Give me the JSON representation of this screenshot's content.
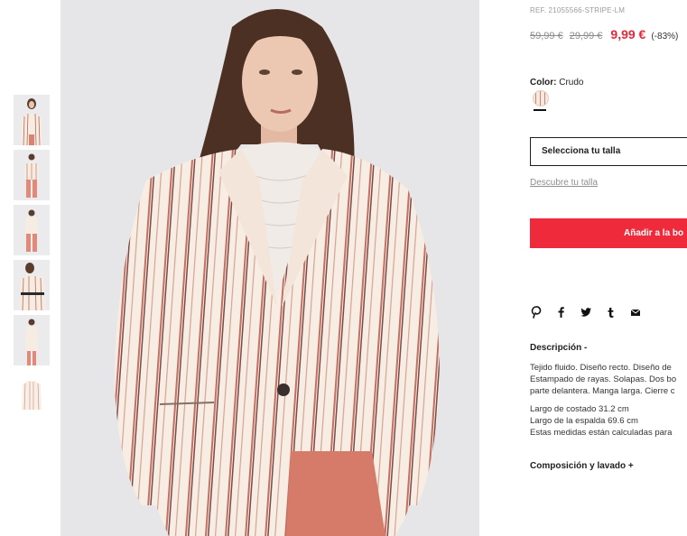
{
  "product": {
    "ref": "REF. 21055566-STRIPE-LM",
    "old_price_1": "59,99 €",
    "old_price_2": "29,99 €",
    "sale_price": "9,99 €",
    "discount": "(-83%)"
  },
  "color": {
    "label": "Color:",
    "value": "Crudo",
    "swatch_colors": [
      "#f7e9de",
      "#c98676"
    ]
  },
  "size": {
    "select_label": "Selecciona tu talla",
    "find_size_link": "Descubre tu talla"
  },
  "cart": {
    "add_label": "Añadir a la bo"
  },
  "share_icons": [
    "pinterest-icon",
    "facebook-icon",
    "twitter-icon",
    "tumblr-icon",
    "email-icon"
  ],
  "description": {
    "title": "Descripción -",
    "lines": [
      "Tejido fluido. Diseño recto. Diseño de",
      "Estampado de rayas. Solapas. Dos bo",
      "parte delantera. Manga larga. Cierre c",
      "",
      "Largo de costado 31.2 cm",
      "Largo de la espalda 69.6 cm",
      "Estas medidas están calculadas para"
    ]
  },
  "composition": {
    "title": "Composición y lavado +"
  },
  "colors": {
    "accent_red": "#ee2a3b",
    "price_red": "#e6283a",
    "image_background": "#e6e6e8"
  }
}
